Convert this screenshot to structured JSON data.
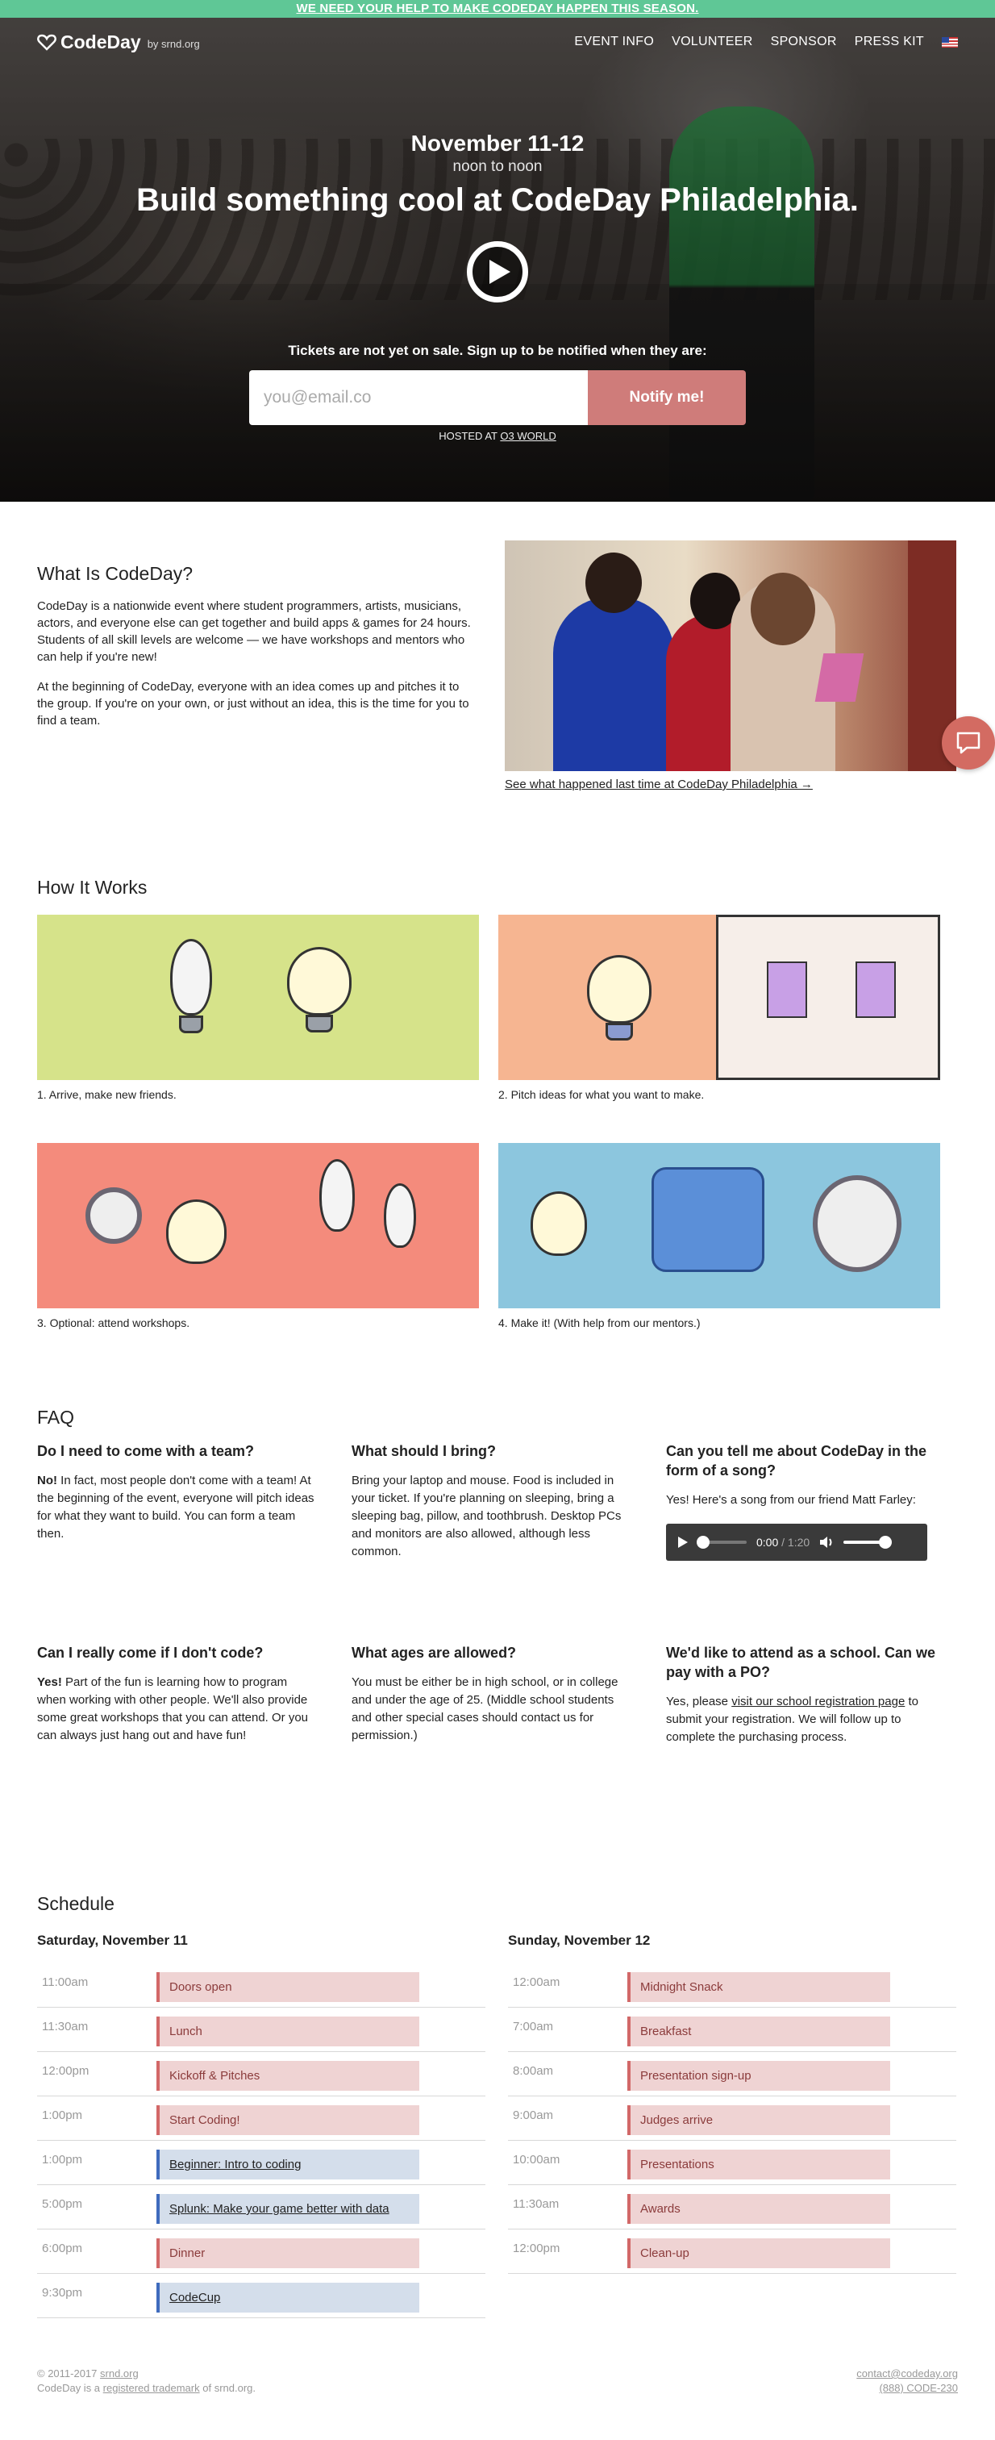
{
  "banner": {
    "text": "WE NEED YOUR HELP TO MAKE CODEDAY HAPPEN THIS SEASON."
  },
  "nav": {
    "logo_name": "CodeDay",
    "logo_by": "by srnd.org",
    "links": [
      "EVENT INFO",
      "VOLUNTEER",
      "SPONSOR",
      "PRESS KIT"
    ],
    "flag_icon": "us-flag-icon"
  },
  "hero": {
    "date": "November 11-12",
    "time": "noon to noon",
    "title": "Build something cool at CodeDay Philadelphia.",
    "play_icon": "play-icon",
    "notify_text": "Tickets are not yet on sale. Sign up to be notified when they are:",
    "email_placeholder": "you@email.co",
    "notify_button": "Notify me!",
    "hosted_prefix": "HOSTED AT",
    "hosted_venue": "O3 WORLD"
  },
  "what": {
    "heading": "What Is CodeDay?",
    "p1": "CodeDay is a nationwide event where student programmers, artists, musicians, actors, and everyone else can get together and build apps & games for 24 hours. Students of all skill levels are welcome — we have workshops and mentors who can help if you're new!",
    "p2": "At the beginning of CodeDay, everyone with an idea comes up and pitches it to the group. If you're on your own, or just without an idea, this is the time for you to find a team.",
    "photo_link": "See what happened last time at CodeDay Philadelphia →",
    "chat_icon": "chat-icon"
  },
  "how": {
    "heading": "How It Works",
    "steps": [
      "1. Arrive, make new friends.",
      "2. Pitch ideas for what you want to make.",
      "3. Optional: attend workshops.",
      "4. Make it! (With help from our mentors.)"
    ]
  },
  "faq": {
    "heading": "FAQ",
    "items": [
      {
        "q": "Do I need to come with a team?",
        "lead": "No!",
        "a": " In fact, most people don't come with a team! At the beginning of the event, everyone will pitch ideas for what they want to build. You can form a team then."
      },
      {
        "q": "What should I bring?",
        "lead": "",
        "a": "Bring your laptop and mouse. Food is included in your ticket. If you're planning on sleeping, bring a sleeping bag, pillow, and toothbrush. Desktop PCs and monitors are also allowed, although less common."
      },
      {
        "q": "Can you tell me about CodeDay in the form of a song?",
        "lead": "",
        "a": "Yes! Here's a song from our friend Matt Farley:"
      },
      {
        "q": "Can I really come if I don't code?",
        "lead": "Yes!",
        "a": " Part of the fun is learning how to program when working with other people. We'll also provide some great workshops that you can attend. Or you can always just hang out and have fun!"
      },
      {
        "q": "What ages are allowed?",
        "lead": "",
        "a": "You must be either be in high school, or in college and under the age of 25. (Middle school students and other special cases should contact us for permission.)"
      },
      {
        "q": "We'd like to attend as a school. Can we pay with a PO?",
        "lead": "",
        "a_pre": "Yes, please ",
        "a_link": "visit our school registration page",
        "a_post": " to submit your registration. We will follow up to complete the purchasing process."
      }
    ],
    "audio": {
      "current": "0:00",
      "duration": "1:20",
      "progress": 0,
      "volume": 0.85
    }
  },
  "schedule": {
    "heading": "Schedule",
    "days": [
      {
        "title": "Saturday, November 11",
        "events": [
          {
            "time": "11:00am",
            "name": "Doors open",
            "kind": "event"
          },
          {
            "time": "11:30am",
            "name": "Lunch",
            "kind": "event"
          },
          {
            "time": "12:00pm",
            "name": "Kickoff & Pitches",
            "kind": "event"
          },
          {
            "time": "1:00pm",
            "name": "Start Coding!",
            "kind": "event"
          },
          {
            "time": "1:00pm",
            "name": "Beginner: Intro to coding",
            "kind": "workshop"
          },
          {
            "time": "5:00pm",
            "name": "Splunk: Make your game better with data",
            "kind": "workshop"
          },
          {
            "time": "6:00pm",
            "name": "Dinner",
            "kind": "event"
          },
          {
            "time": "9:30pm",
            "name": "CodeCup",
            "kind": "workshop"
          }
        ]
      },
      {
        "title": "Sunday, November 12",
        "events": [
          {
            "time": "12:00am",
            "name": "Midnight Snack",
            "kind": "event"
          },
          {
            "time": "7:00am",
            "name": "Breakfast",
            "kind": "event"
          },
          {
            "time": "8:00am",
            "name": "Presentation sign-up",
            "kind": "event"
          },
          {
            "time": "9:00am",
            "name": "Judges arrive",
            "kind": "event"
          },
          {
            "time": "10:00am",
            "name": "Presentations",
            "kind": "event"
          },
          {
            "time": "11:30am",
            "name": "Awards",
            "kind": "event"
          },
          {
            "time": "12:00pm",
            "name": "Clean-up",
            "kind": "event"
          }
        ]
      }
    ]
  },
  "footer": {
    "copyright_prefix": "© 2011-2017",
    "copyright_link": "srnd.org",
    "tm_prefix": "CodeDay is a",
    "tm_link": "registered trademark",
    "tm_suffix": "of srnd.org.",
    "email": "contact@codeday.org",
    "phone": "(888) CODE-230"
  },
  "colors": {
    "banner": "#5fc796",
    "accent": "#cf7c7a",
    "event": "#efd3d3",
    "workshop": "#d4deeb"
  }
}
